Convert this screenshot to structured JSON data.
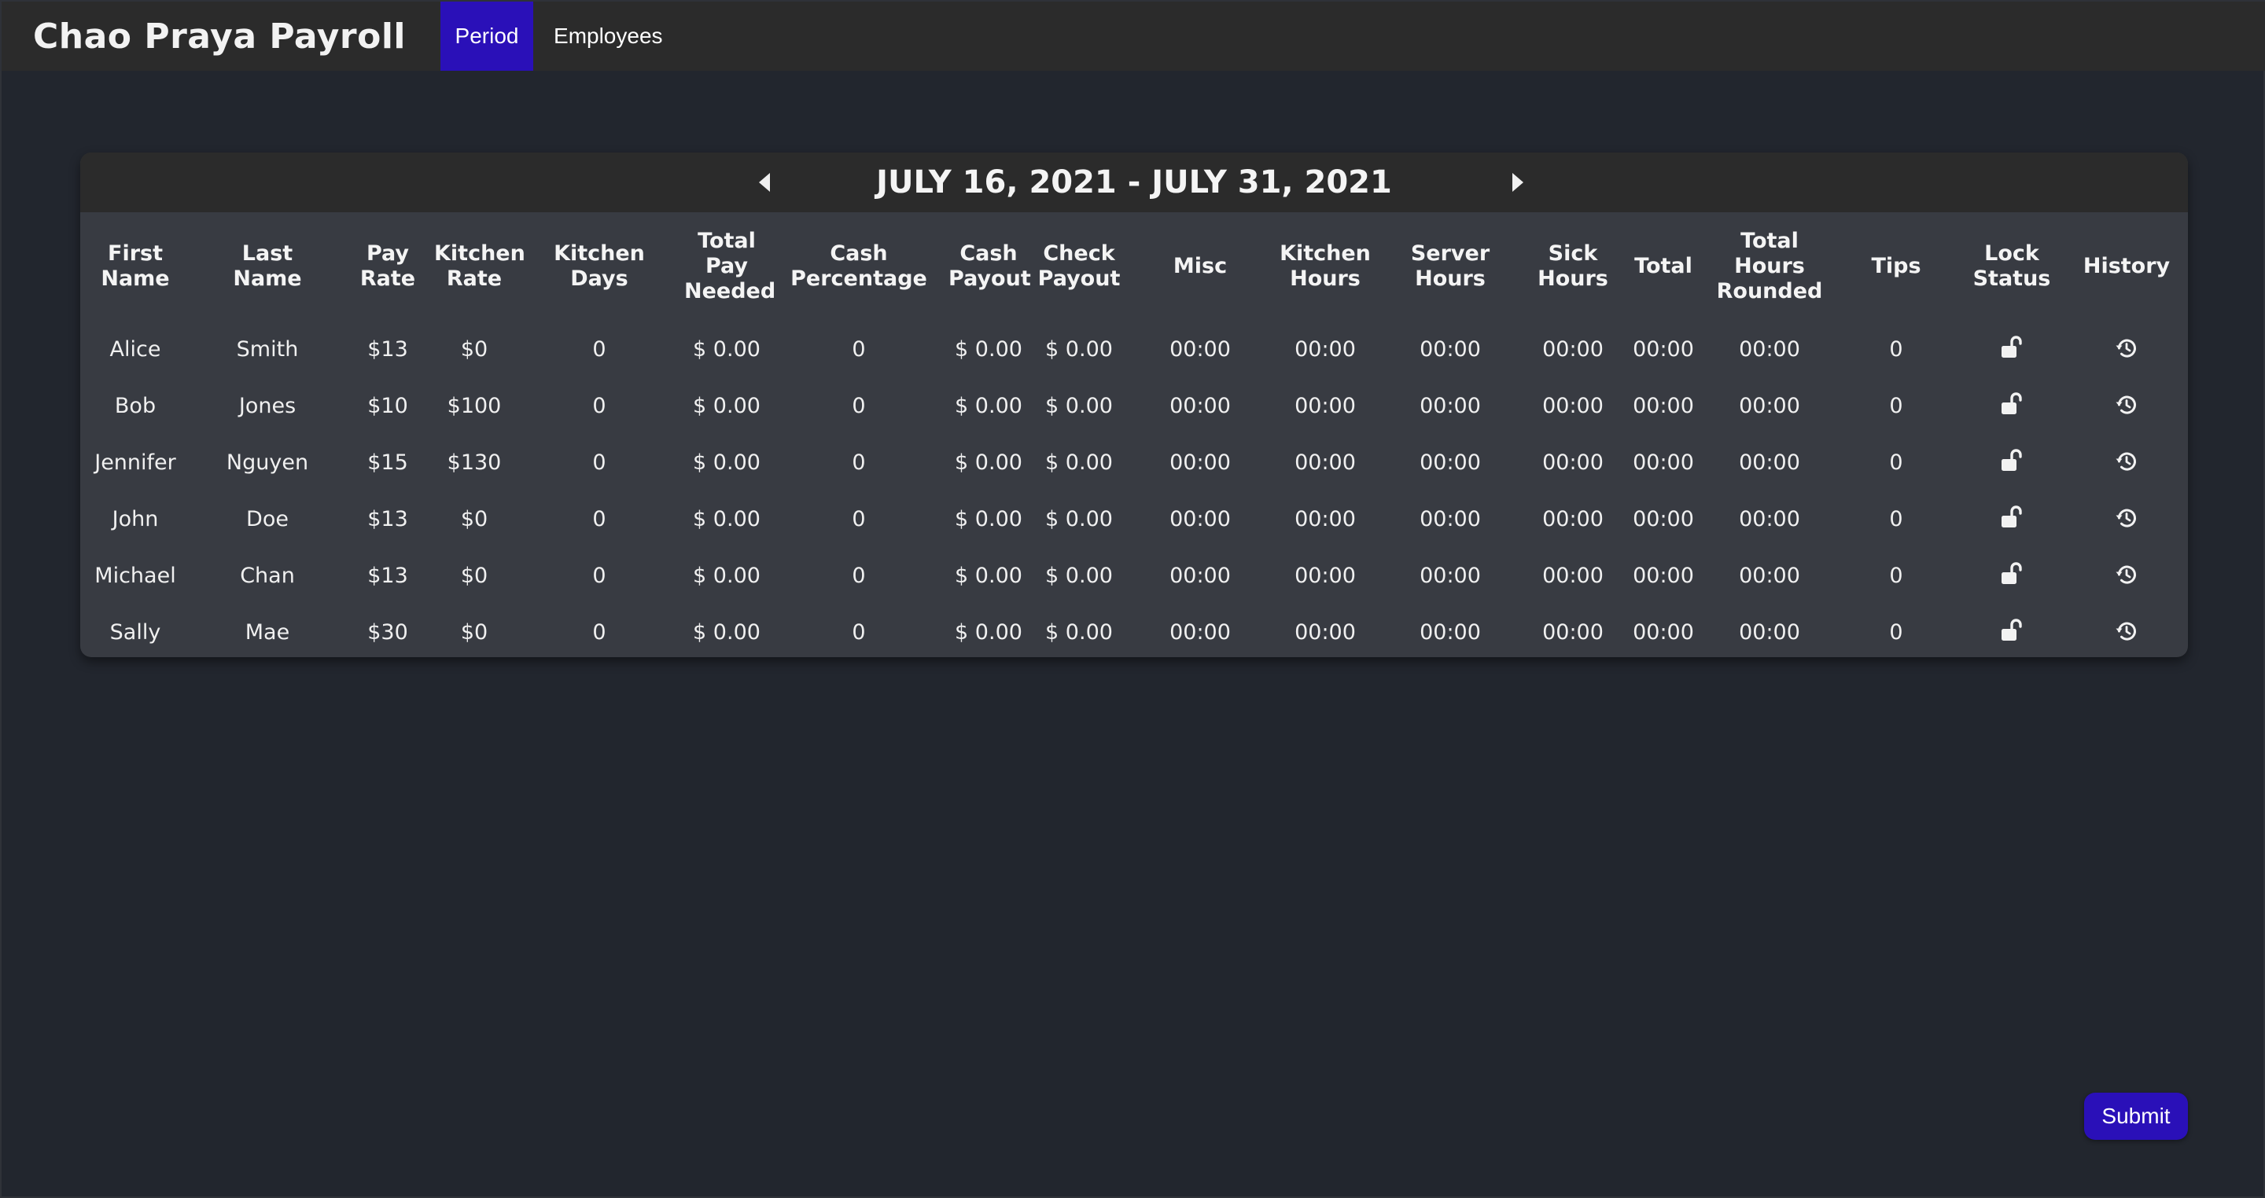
{
  "app": {
    "title": "Chao Praya Payroll"
  },
  "nav": {
    "tabs": [
      {
        "label": "Period",
        "active": true
      },
      {
        "label": "Employees",
        "active": false
      }
    ]
  },
  "period": {
    "title": "JULY 16, 2021 - JULY 31, 2021",
    "prev_icon": "caret-left-icon",
    "next_icon": "caret-right-icon"
  },
  "table": {
    "columns": [
      [
        "First",
        "Name"
      ],
      [
        "Last",
        "Name"
      ],
      [
        "Pay",
        "Rate"
      ],
      [
        "Kitchen",
        "Rate"
      ],
      [
        "Kitchen",
        "Days"
      ],
      [
        "Total",
        "Pay",
        "Needed"
      ],
      [
        "Cash",
        "Percentage"
      ],
      [
        "Cash",
        "Payout"
      ],
      [
        "Check",
        "Payout"
      ],
      [
        "Misc"
      ],
      [
        "Kitchen",
        "Hours"
      ],
      [
        "Server",
        "Hours"
      ],
      [
        "Sick Hours"
      ],
      [
        "Total"
      ],
      [
        "Total",
        "Hours",
        "Rounded"
      ],
      [
        "Tips"
      ],
      [
        "Lock",
        "Status"
      ],
      [
        "History"
      ]
    ],
    "rows": [
      {
        "first_name": "Alice",
        "last_name": "Smith",
        "pay_rate": "$13",
        "kitchen_rate": "$0",
        "kitchen_days": "0",
        "total_pay_needed": "$ 0.00",
        "cash_percentage": "0",
        "cash_payout": "$ 0.00",
        "check_payout": "$ 0.00",
        "misc": "00:00",
        "kitchen_hours": "00:00",
        "server_hours": "00:00",
        "sick_hours": "00:00",
        "total": "00:00",
        "total_hours_rounded": "00:00",
        "tips": "0",
        "lock_icon": "unlock-icon",
        "history_icon": "history-icon"
      },
      {
        "first_name": "Bob",
        "last_name": "Jones",
        "pay_rate": "$10",
        "kitchen_rate": "$100",
        "kitchen_days": "0",
        "total_pay_needed": "$ 0.00",
        "cash_percentage": "0",
        "cash_payout": "$ 0.00",
        "check_payout": "$ 0.00",
        "misc": "00:00",
        "kitchen_hours": "00:00",
        "server_hours": "00:00",
        "sick_hours": "00:00",
        "total": "00:00",
        "total_hours_rounded": "00:00",
        "tips": "0",
        "lock_icon": "unlock-icon",
        "history_icon": "history-icon"
      },
      {
        "first_name": "Jennifer",
        "last_name": "Nguyen",
        "pay_rate": "$15",
        "kitchen_rate": "$130",
        "kitchen_days": "0",
        "total_pay_needed": "$ 0.00",
        "cash_percentage": "0",
        "cash_payout": "$ 0.00",
        "check_payout": "$ 0.00",
        "misc": "00:00",
        "kitchen_hours": "00:00",
        "server_hours": "00:00",
        "sick_hours": "00:00",
        "total": "00:00",
        "total_hours_rounded": "00:00",
        "tips": "0",
        "lock_icon": "unlock-icon",
        "history_icon": "history-icon"
      },
      {
        "first_name": "John",
        "last_name": "Doe",
        "pay_rate": "$13",
        "kitchen_rate": "$0",
        "kitchen_days": "0",
        "total_pay_needed": "$ 0.00",
        "cash_percentage": "0",
        "cash_payout": "$ 0.00",
        "check_payout": "$ 0.00",
        "misc": "00:00",
        "kitchen_hours": "00:00",
        "server_hours": "00:00",
        "sick_hours": "00:00",
        "total": "00:00",
        "total_hours_rounded": "00:00",
        "tips": "0",
        "lock_icon": "unlock-icon",
        "history_icon": "history-icon"
      },
      {
        "first_name": "Michael",
        "last_name": "Chan",
        "pay_rate": "$13",
        "kitchen_rate": "$0",
        "kitchen_days": "0",
        "total_pay_needed": "$ 0.00",
        "cash_percentage": "0",
        "cash_payout": "$ 0.00",
        "check_payout": "$ 0.00",
        "misc": "00:00",
        "kitchen_hours": "00:00",
        "server_hours": "00:00",
        "sick_hours": "00:00",
        "total": "00:00",
        "total_hours_rounded": "00:00",
        "tips": "0",
        "lock_icon": "unlock-icon",
        "history_icon": "history-icon"
      },
      {
        "first_name": "Sally",
        "last_name": "Mae",
        "pay_rate": "$30",
        "kitchen_rate": "$0",
        "kitchen_days": "0",
        "total_pay_needed": "$ 0.00",
        "cash_percentage": "0",
        "cash_payout": "$ 0.00",
        "check_payout": "$ 0.00",
        "misc": "00:00",
        "kitchen_hours": "00:00",
        "server_hours": "00:00",
        "sick_hours": "00:00",
        "total": "00:00",
        "total_hours_rounded": "00:00",
        "tips": "0",
        "lock_icon": "unlock-icon",
        "history_icon": "history-icon"
      }
    ]
  },
  "footer": {
    "submit_label": "Submit"
  },
  "colors": {
    "background": "#22262e",
    "navbar": "#2b2b2b",
    "accent": "#2a10b8",
    "card": "#383b42",
    "text": "#f0f0f0"
  }
}
